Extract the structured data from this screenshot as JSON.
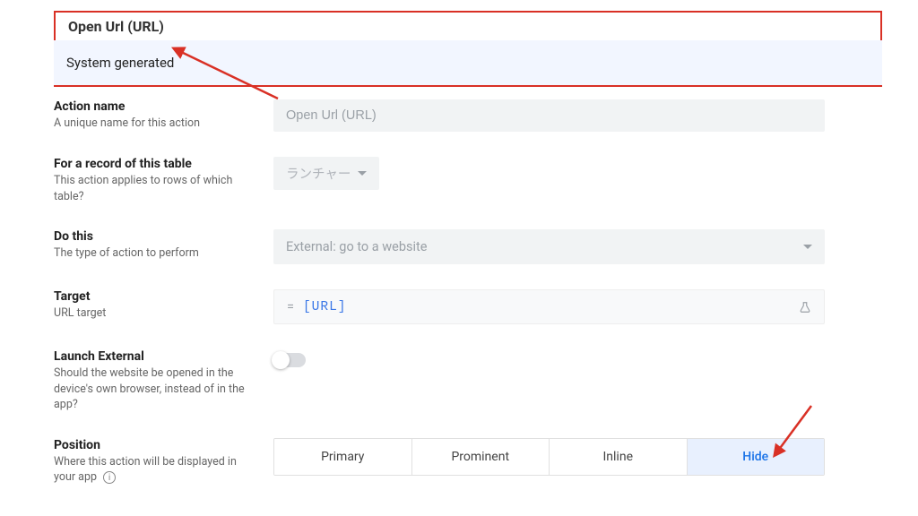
{
  "header": {
    "title": "Open Url (URL)",
    "system": "System generated"
  },
  "fields": {
    "name": {
      "label": "Action name",
      "desc": "A unique name for this action",
      "value": "Open Url (URL)"
    },
    "table": {
      "label": "For a record of this table",
      "desc": "This action applies to rows of which table?",
      "value": "ランチャー"
    },
    "do": {
      "label": "Do this",
      "desc": "The type of action to perform",
      "value": "External: go to a website"
    },
    "target": {
      "label": "Target",
      "desc": "URL target",
      "prefix": "=",
      "value": "[URL]"
    },
    "launch": {
      "label": "Launch External",
      "desc": "Should the website be opened in the device's own browser, instead of in the app?"
    },
    "position": {
      "label": "Position",
      "desc": "Where this action will be displayed in your app",
      "options": [
        "Primary",
        "Prominent",
        "Inline",
        "Hide"
      ],
      "selected": "Hide"
    }
  }
}
